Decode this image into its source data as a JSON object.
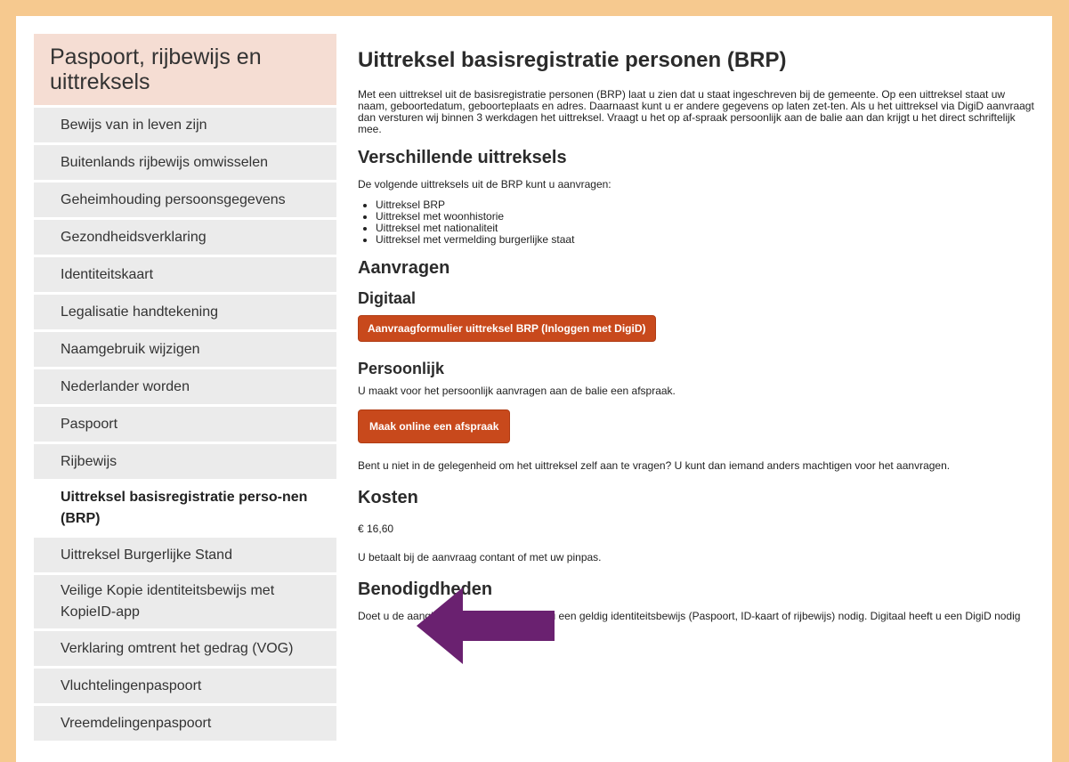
{
  "sidebar": {
    "title": "Paspoort, rijbewijs en uittreksels",
    "items": [
      {
        "label": "Bewijs van in leven zijn"
      },
      {
        "label": "Buitenlands rijbewijs omwisselen"
      },
      {
        "label": "Geheimhouding persoonsgegevens"
      },
      {
        "label": "Gezondheidsverklaring"
      },
      {
        "label": "Identiteitskaart"
      },
      {
        "label": "Legalisatie handtekening"
      },
      {
        "label": "Naamgebruik wijzigen"
      },
      {
        "label": "Nederlander worden"
      },
      {
        "label": "Paspoort"
      },
      {
        "label": "Rijbewijs"
      },
      {
        "label": "Uittreksel basisregistratie perso-nen (BRP)"
      },
      {
        "label": "Uittreksel Burgerlijke Stand"
      },
      {
        "label": "Veilige Kopie identiteitsbewijs met KopieID-app"
      },
      {
        "label": "Verklaring omtrent het gedrag (VOG)"
      },
      {
        "label": "Vluchtelingenpaspoort"
      },
      {
        "label": "Vreemdelingenpaspoort"
      }
    ]
  },
  "main": {
    "title": "Uittreksel basisregistratie personen (BRP)",
    "intro": "Met een uittreksel uit de basisregistratie personen (BRP) laat u zien dat u staat ingeschreven bij de gemeente. Op een uittreksel staat uw naam, geboortedatum, geboorteplaats en adres. Daarnaast kunt u er andere gegevens op laten zet-ten. Als u het uittreksel via DigiD aanvraagt dan versturen wij binnen 3 werkdagen het uittreksel. Vraagt u het op af-spraak persoonlijk aan de balie aan dan krijgt u het direct schriftelijk mee.",
    "h_verschillende": "Verschillende uittreksels",
    "verschillende_intro": "De volgende uittreksels uit de BRP kunt u aanvragen:",
    "list": [
      "Uittreksel BRP",
      "Uittreksel met woonhistorie",
      "Uittreksel met nationaliteit",
      "Uittreksel met vermelding burgerlijke staat"
    ],
    "h_aanvragen": "Aanvragen",
    "h_digitaal": "Digitaal",
    "btn_digid": "Aanvraagformulier uittreksel BRP (Inloggen met DigiD)",
    "h_persoonlijk": "Persoonlijk",
    "persoonlijk_text": "U maakt voor het persoonlijk aanvragen aan de balie een afspraak.",
    "btn_afspraak": "Maak online een afspraak",
    "machtigen_text": "Bent u niet in de gelegenheid om het uittreksel zelf aan te vragen? U kunt dan iemand anders machtigen voor het aanvragen.",
    "h_kosten": "Kosten",
    "price": "€ 16,60",
    "betaal_text": "U betaalt bij de aanvraag contant of met uw pinpas.",
    "h_benodigdheden": "Benodigdheden",
    "benodigd_text": "Doet u de aangifte persoonlijk dan heeft u een geldig identiteitsbewijs (Paspoort, ID-kaart of rijbewijs) nodig. Digitaal heeft u een DigiD nodig"
  },
  "colors": {
    "frame": "#f6c98f",
    "button": "#c8491c",
    "arrow": "#6a2170",
    "sidebar_title_bg": "#f5ddd3"
  }
}
